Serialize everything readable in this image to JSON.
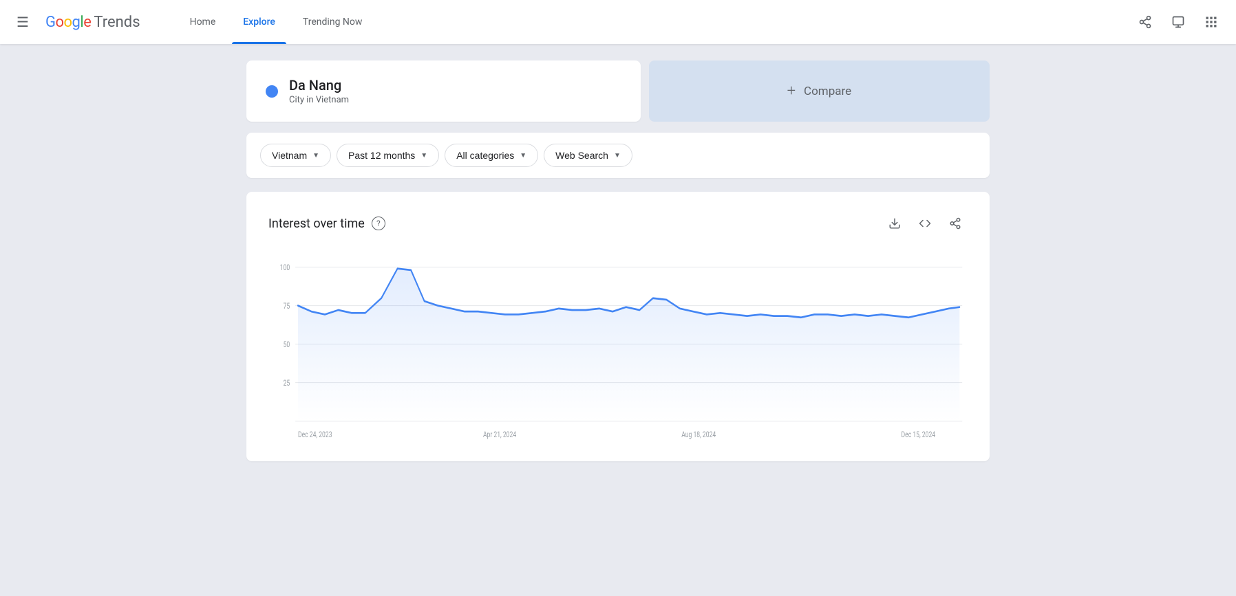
{
  "header": {
    "menu_label": "Menu",
    "logo_google": "Google",
    "logo_trends": "Trends",
    "nav": {
      "home": "Home",
      "explore": "Explore",
      "trending_now": "Trending Now"
    },
    "icons": {
      "share": "share",
      "feedback": "feedback",
      "apps": "apps"
    }
  },
  "search": {
    "term": "Da Nang",
    "subtitle": "City in Vietnam",
    "compare_label": "Compare"
  },
  "filters": {
    "region": "Vietnam",
    "time": "Past 12 months",
    "category": "All categories",
    "type": "Web Search"
  },
  "chart": {
    "title": "Interest over time",
    "help_tooltip": "?",
    "y_labels": [
      "100",
      "75",
      "50",
      "25"
    ],
    "x_labels": [
      "Dec 24, 2023",
      "Apr 21, 2024",
      "Aug 18, 2024",
      "Dec 15, 2024"
    ],
    "actions": {
      "download": "download",
      "embed": "embed",
      "share": "share"
    }
  }
}
